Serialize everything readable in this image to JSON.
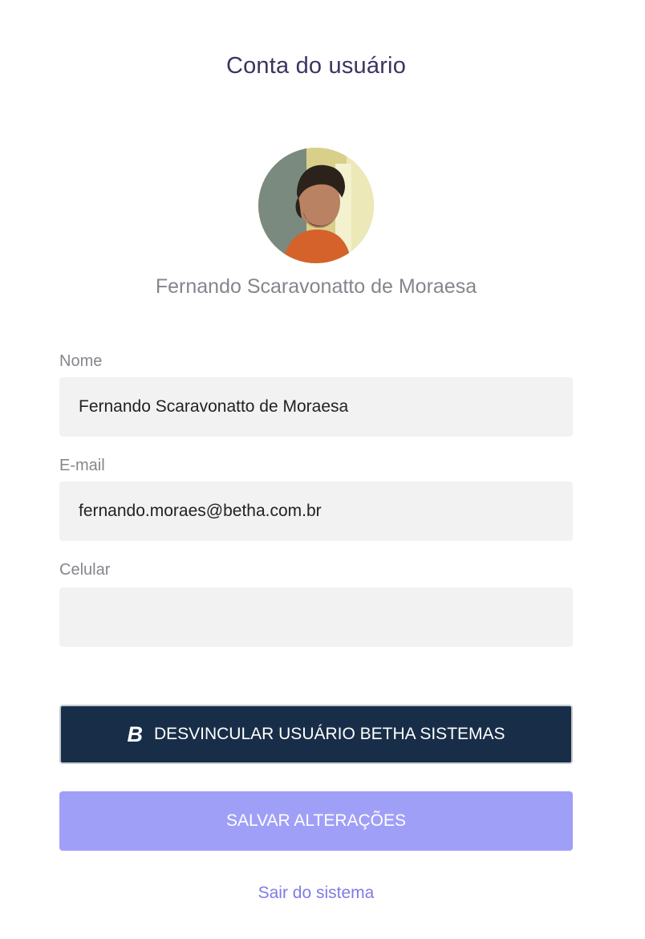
{
  "header": {
    "title": "Conta do usuário"
  },
  "profile": {
    "avatar_icon": "user-photo",
    "display_name": "Fernando Scaravonatto de Moraesa"
  },
  "form": {
    "name": {
      "label": "Nome",
      "value": "Fernando Scaravonatto de Moraesa"
    },
    "email": {
      "label": "E-mail",
      "value": "fernando.moraes@betha.com.br"
    },
    "phone": {
      "label": "Celular",
      "value": ""
    }
  },
  "actions": {
    "unlink_icon": "B",
    "unlink_label": "DESVINCULAR USUÁRIO BETHA SISTEMAS",
    "save_label": "SALVAR ALTERAÇÕES",
    "logout_label": "Sair do sistema"
  },
  "colors": {
    "title": "#3a3560",
    "unlink_button_bg": "#182e48",
    "save_button_bg": "#a09ff8",
    "link": "#7f7ce6",
    "input_bg": "#f2f2f2"
  }
}
